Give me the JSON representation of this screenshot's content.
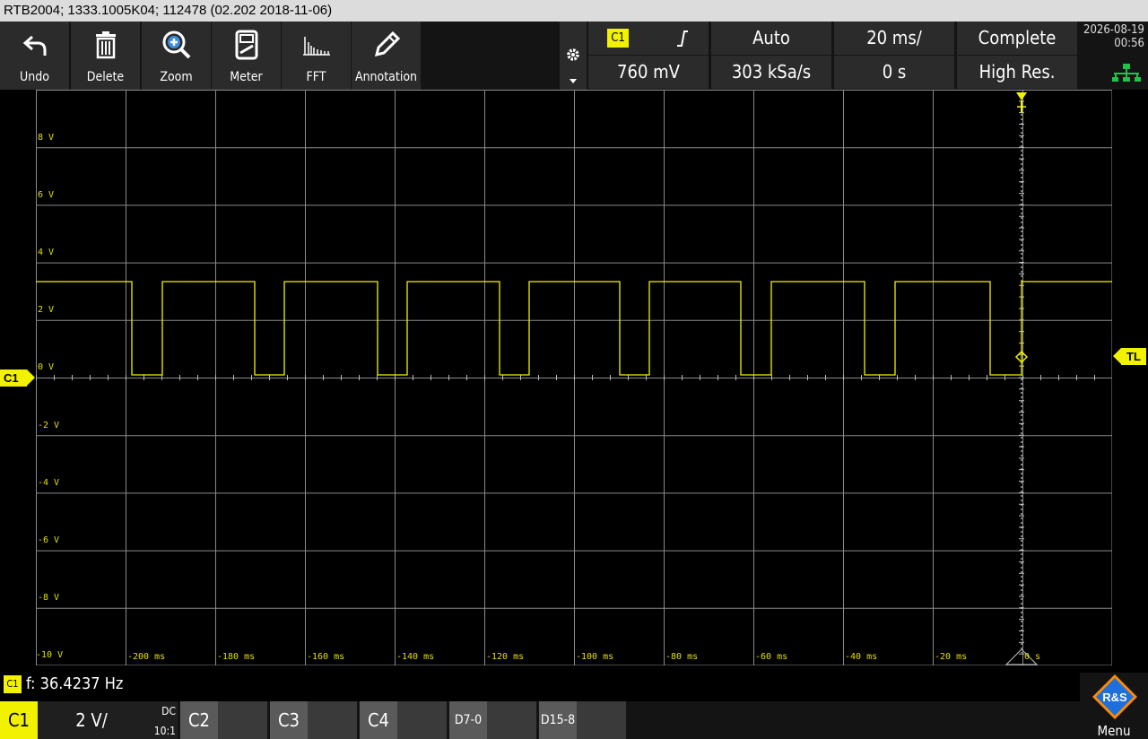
{
  "title_bar": "RTB2004; 1333.1005K04; 112478 (02.202 2018-11-06)",
  "toolbar": {
    "tools": [
      {
        "label": "Undo",
        "icon": "undo-icon"
      },
      {
        "label": "Delete",
        "icon": "trash-icon"
      },
      {
        "label": "Zoom",
        "icon": "zoom-in-icon"
      },
      {
        "label": "Meter",
        "icon": "meter-icon"
      },
      {
        "label": "FFT",
        "icon": "fft-icon"
      },
      {
        "label": "Annotation",
        "icon": "pencil-icon"
      }
    ],
    "settings_icon": "gear-icon"
  },
  "status": {
    "trigger_source": "C1",
    "trigger_slope_icon": "rising-edge-icon",
    "trigger_level": "760 mV",
    "trigger_mode": "Auto",
    "sample_rate": "303 kSa/s",
    "time_scale": "20 ms/",
    "time_offset": "0 s",
    "acq_state": "Complete",
    "acq_mode": "High Res.",
    "date": "2026-08-19",
    "time": "00:56",
    "network_icon": "network-icon"
  },
  "plot": {
    "y_labels": [
      "8 V",
      "6 V",
      "4 V",
      "2 V",
      "0 V",
      "-2 V",
      "-4 V",
      "-6 V",
      "-8 V",
      "-10 V"
    ],
    "x_labels": [
      "-200 ms",
      "-180 ms",
      "-160 ms",
      "-140 ms",
      "-120 ms",
      "-100 ms",
      "-80 ms",
      "-60 ms",
      "-40 ms",
      "-20 ms",
      "0 s"
    ],
    "channel_marker": "C1",
    "trigger_level_marker": "TL",
    "trace_color": "#f2f200"
  },
  "measurement": {
    "channel": "C1",
    "text": "f: 36.4237 Hz"
  },
  "channels": {
    "c1_label": "C1",
    "c1_scale": "2 V/",
    "c1_coupling": "DC",
    "c1_probe": "10:1",
    "c2_label": "C2",
    "c3_label": "C3",
    "c4_label": "C4",
    "d70_label": "D7-0",
    "d158_label": "D15-8",
    "menu_label": "Menu",
    "logo_text": "R&S"
  }
}
